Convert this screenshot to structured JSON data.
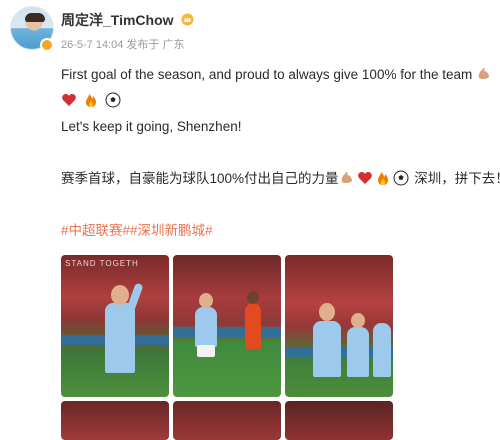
{
  "post": {
    "username": "周定洋_TimChow",
    "meta": "26-5-7 14:04 发布于 广东",
    "line1": "First goal of the season, and proud to always give 100% for the team",
    "line3": "Let's keep it going, Shenzhen!",
    "line4_a": "赛季首球，自豪能为球队100%付出自己的力量",
    "line4_b": "深圳，拼下去！",
    "hashtags": "#中超联赛##深圳新鹏城#"
  },
  "emoji_icons": [
    "flexed-biceps",
    "red-heart",
    "fire",
    "soccer-ball"
  ],
  "photos": {
    "banner_text": "STAND TOGETH"
  },
  "colors": {
    "hashtag": "#eb7350",
    "meta": "#9a9a9a",
    "badge": "#f5a623"
  }
}
